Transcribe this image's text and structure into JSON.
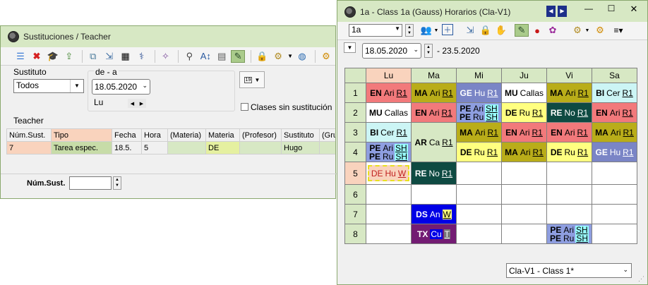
{
  "left_window": {
    "title": "Sustituciones / Teacher",
    "filter": {
      "sustituto_label": "Sustituto",
      "sustituto_value": "Todos",
      "range_label": "de - a",
      "date_value": "18.05.2020",
      "day_value": "Lu",
      "no_sub_checkbox_label": "Clases sin sustitución"
    },
    "section_label": "Teacher",
    "table": {
      "headers": [
        "Núm.Sust.",
        "Tipo",
        "Fecha",
        "Hora",
        "(Materia)",
        "Materia",
        "(Profesor)",
        "Sustituto",
        "(Gru"
      ],
      "rows": [
        [
          "7",
          "Tarea espec.",
          "18.5.",
          "5",
          "",
          "DE",
          "",
          "Hugo",
          ""
        ]
      ]
    },
    "footer_label": "Núm.Sust."
  },
  "right_window": {
    "title": "1a - Class 1a (Gauss)  Horarios  (Cla-V1)",
    "class_select": "1a",
    "date_value": "18.05.2020",
    "date_range_end": "- 23.5.2020",
    "days": [
      "Lu",
      "Ma",
      "Mi",
      "Ju",
      "Vi",
      "Sa"
    ],
    "periods": [
      "1",
      "2",
      "3",
      "4",
      "5",
      "6",
      "7",
      "8"
    ],
    "footer_select": "Cla-V1 - Class 1*"
  },
  "timetable": {
    "r1": {
      "lu": {
        "s": "EN",
        "t": "Ari",
        "r": "R1"
      },
      "ma": {
        "s": "MA",
        "t": "Ari",
        "r": "R1"
      },
      "mi": {
        "s": "GE",
        "t": "Hu",
        "r": "R1"
      },
      "ju": {
        "s": "MU",
        "t": "Callas",
        "r": ""
      },
      "vi": {
        "s": "MA",
        "t": "Ari",
        "r": "R1"
      },
      "sa": {
        "s": "BI",
        "t": "Cer",
        "r": "R1"
      }
    },
    "r2": {
      "lu": {
        "s": "MU",
        "t": "Callas",
        "r": ""
      },
      "ma": {
        "s": "EN",
        "t": "Ari",
        "r": "R1"
      },
      "mi": {
        "a": {
          "s": "PE",
          "t": "Ari",
          "r": "SH"
        },
        "b": {
          "s": "PE",
          "t": "Ru",
          "r": "SH"
        }
      },
      "ju": {
        "s": "DE",
        "t": "Ru",
        "r": "R1"
      },
      "vi": {
        "s": "RE",
        "t": "No",
        "r": "R1"
      },
      "sa": {
        "s": "EN",
        "t": "Ari",
        "r": "R1"
      }
    },
    "r3": {
      "lu": {
        "s": "BI",
        "t": "Cer",
        "r": "R1"
      },
      "ma": {
        "s": "AR",
        "t": "Ca",
        "r": "R1"
      },
      "mi": {
        "s": "MA",
        "t": "Ari",
        "r": "R1"
      },
      "ju": {
        "s": "EN",
        "t": "Ari",
        "r": "R1"
      },
      "vi": {
        "s": "EN",
        "t": "Ari",
        "r": "R1"
      },
      "sa": {
        "s": "MA",
        "t": "Ari",
        "r": "R1"
      }
    },
    "r4": {
      "lu": {
        "a": {
          "s": "PE",
          "t": "Ari",
          "r": "SH"
        },
        "b": {
          "s": "PE",
          "t": "Ru",
          "r": "SH"
        }
      },
      "mi": {
        "s": "DE",
        "t": "Ru",
        "r": "R1"
      },
      "ju": {
        "s": "MA",
        "t": "Ari",
        "r": "R1"
      },
      "vi": {
        "s": "DE",
        "t": "Ru",
        "r": "R1"
      },
      "sa": {
        "s": "GE",
        "t": "Hu",
        "r": "R1"
      }
    },
    "r5": {
      "lu": {
        "s": "DE",
        "t": "Hu",
        "r": "W"
      },
      "ma": {
        "s": "RE",
        "t": "No",
        "r": "R1"
      }
    },
    "r7": {
      "ma": {
        "s": "DS",
        "t": "An",
        "r": "W"
      }
    },
    "r8": {
      "ma": {
        "s": "TX",
        "t": "Cu",
        "r": "T"
      },
      "vi": {
        "a": {
          "s": "PE",
          "t": "Ari",
          "r": "SH"
        },
        "b": {
          "s": "PE",
          "t": "Ru",
          "r": "SH"
        }
      }
    }
  },
  "colors": {
    "EN": "#f2797b",
    "MA": "#b9ad19",
    "GE": "#7a85c6",
    "MU": "#ffffff",
    "BI": "#ccf5f5",
    "PE": "#8e9ee0",
    "DE": "#ffff80",
    "RE": "#0e4a42",
    "AR": "#d7e8c4",
    "DS": "#0000e6",
    "TX": "#731c73",
    "header": "#d7e8c4",
    "current": "#f9d3bd"
  }
}
